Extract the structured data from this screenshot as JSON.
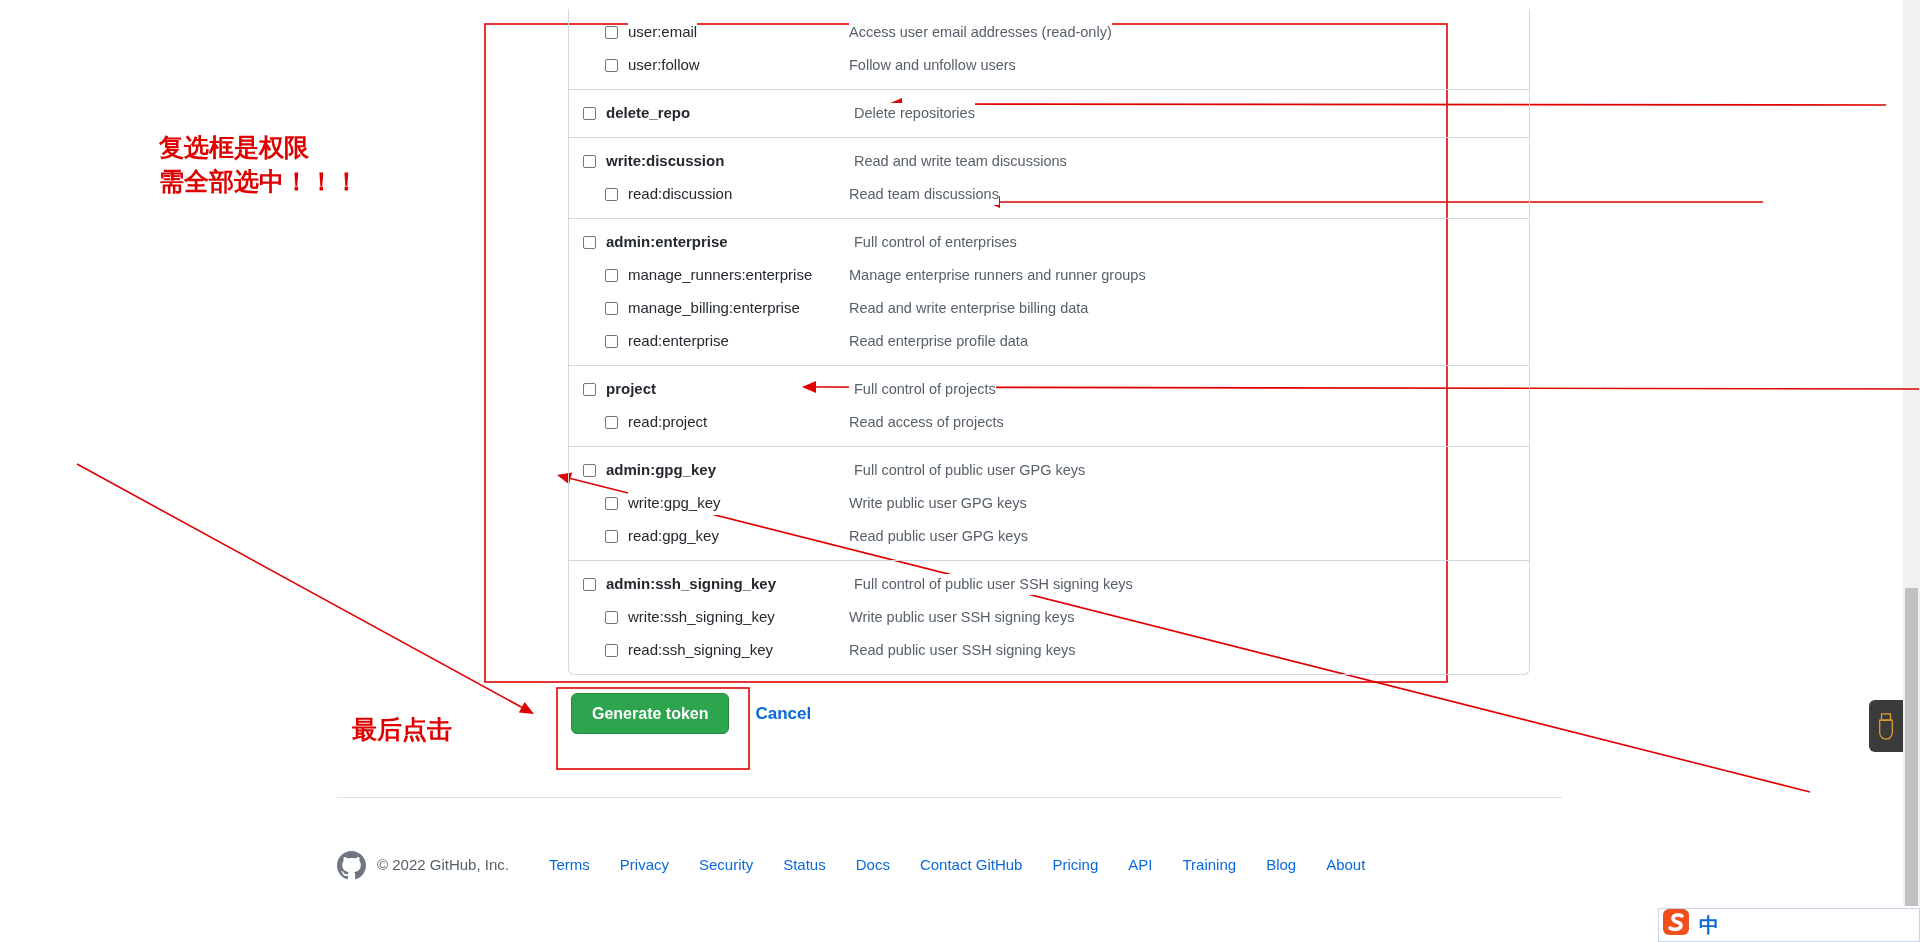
{
  "scope_groups": [
    {
      "children": [
        {
          "name": "user:email",
          "description": "Access user email addresses (read-only)",
          "checked": false
        },
        {
          "name": "user:follow",
          "description": "Follow and unfollow users",
          "checked": false
        }
      ]
    },
    {
      "scope": {
        "name": "delete_repo",
        "description": "Delete repositories",
        "checked": false
      }
    },
    {
      "scope": {
        "name": "write:discussion",
        "description": "Read and write team discussions",
        "checked": false
      },
      "children": [
        {
          "name": "read:discussion",
          "description": "Read team discussions",
          "checked": false
        }
      ]
    },
    {
      "scope": {
        "name": "admin:enterprise",
        "description": "Full control of enterprises",
        "checked": false
      },
      "children": [
        {
          "name": "manage_runners:enterprise",
          "description": "Manage enterprise runners and runner groups",
          "checked": false
        },
        {
          "name": "manage_billing:enterprise",
          "description": "Read and write enterprise billing data",
          "checked": false
        },
        {
          "name": "read:enterprise",
          "description": "Read enterprise profile data",
          "checked": false
        }
      ]
    },
    {
      "scope": {
        "name": "project",
        "description": "Full control of projects",
        "checked": false
      },
      "children": [
        {
          "name": "read:project",
          "description": "Read access of projects",
          "checked": false
        }
      ]
    },
    {
      "scope": {
        "name": "admin:gpg_key",
        "description": "Full control of public user GPG keys",
        "checked": false
      },
      "children": [
        {
          "name": "write:gpg_key",
          "description": "Write public user GPG keys",
          "checked": false
        },
        {
          "name": "read:gpg_key",
          "description": "Read public user GPG keys",
          "checked": false
        }
      ]
    },
    {
      "scope": {
        "name": "admin:ssh_signing_key",
        "description": "Full control of public user SSH signing keys",
        "checked": false
      },
      "children": [
        {
          "name": "write:ssh_signing_key",
          "description": "Write public user SSH signing keys",
          "checked": false
        },
        {
          "name": "read:ssh_signing_key",
          "description": "Read public user SSH signing keys",
          "checked": false
        }
      ]
    }
  ],
  "actions": {
    "primary": "Generate token",
    "cancel": "Cancel"
  },
  "footer": {
    "copyright": "© 2022 GitHub, Inc.",
    "links": [
      "Terms",
      "Privacy",
      "Security",
      "Status",
      "Docs",
      "Contact GitHub",
      "Pricing",
      "API",
      "Training",
      "Blog",
      "About"
    ]
  },
  "ime_bar": {
    "mode": "中"
  },
  "annotations": {
    "checkbox_note": [
      "复选框是权限",
      "需全部选中！！！"
    ],
    "button_note": "最后点击"
  }
}
